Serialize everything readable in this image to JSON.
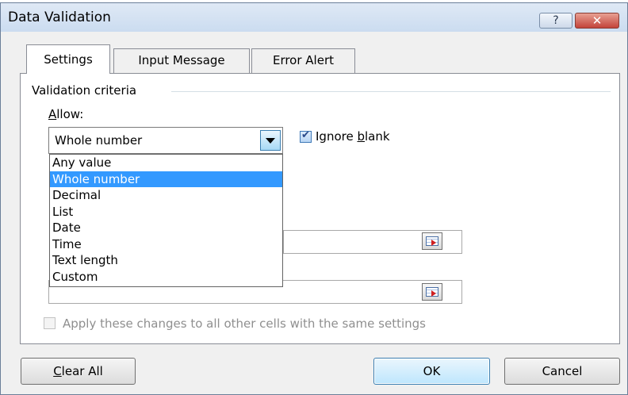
{
  "window": {
    "title": "Data Validation",
    "help_label": "?",
    "close_label": "✕"
  },
  "tabs": [
    {
      "label": "Settings",
      "active": true
    },
    {
      "label": "Input Message",
      "active": false
    },
    {
      "label": "Error Alert",
      "active": false
    }
  ],
  "group": {
    "title": "Validation criteria"
  },
  "allow": {
    "label_prefix": "",
    "label_accel": "A",
    "label_rest": "llow:",
    "value": "Whole number",
    "options": [
      "Any value",
      "Whole number",
      "Decimal",
      "List",
      "Date",
      "Time",
      "Text length",
      "Custom"
    ],
    "selected_index": 1
  },
  "ignore_blank": {
    "checked": true,
    "label_prefix": "Ignore ",
    "label_accel": "b",
    "label_rest": "lank"
  },
  "apply_all": {
    "checked": false,
    "label": "Apply these changes to all other cells with the same settings"
  },
  "buttons": {
    "clear_all_accel": "C",
    "clear_all_rest": "lear All",
    "ok": "OK",
    "cancel": "Cancel"
  },
  "icons": {
    "ref1": "collapse-dialog-icon",
    "ref2": "collapse-dialog-icon",
    "dropdown": "chevron-down-icon",
    "check": "checkmark-icon"
  },
  "colors": {
    "selection": "#3399ff",
    "title_bar": "#cbdcf0",
    "close": "#c3433a"
  }
}
